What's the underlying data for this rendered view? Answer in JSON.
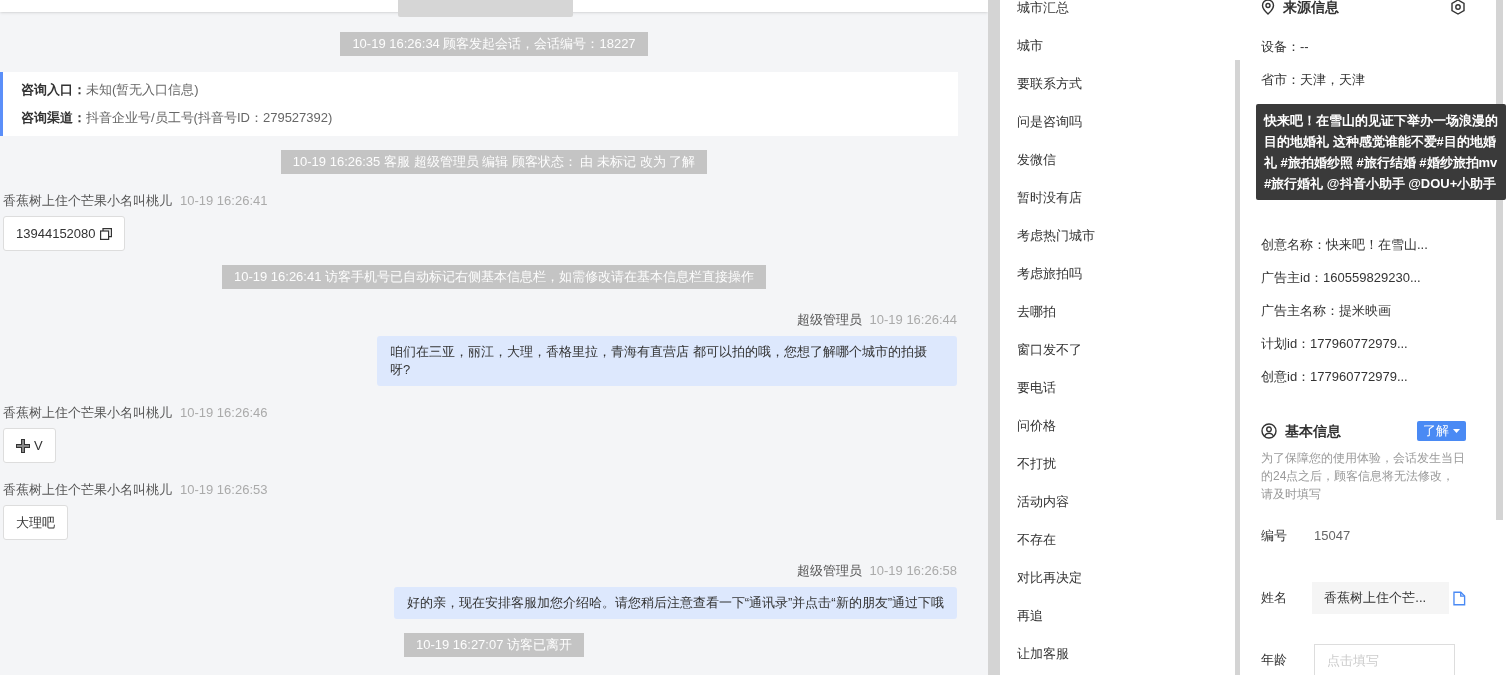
{
  "chat": {
    "messages": [
      {
        "kind": "notice",
        "text": "10-19 16:26:34 顾客发起会话，会话编号：18227"
      },
      {
        "kind": "info",
        "rows": [
          {
            "label": "咨询入口：",
            "value": "未知(暂无入口信息)"
          },
          {
            "label": "咨询渠道：",
            "value": "抖音企业号/员工号(抖音号ID：279527392)"
          }
        ]
      },
      {
        "kind": "notice",
        "text": "10-19 16:26:35 客服 超级管理员 编辑 顾客状态： 由 未标记 改为 了解"
      },
      {
        "kind": "customer",
        "sender": "香蕉树上住个芒果小名叫桃儿",
        "time": "10-19 16:26:41",
        "text": "13944152080",
        "copy": true
      },
      {
        "kind": "notice",
        "text": "10-19 16:26:41 访客手机号已自动标记右侧基本信息栏，如需修改请在基本信息栏直接操作"
      },
      {
        "kind": "agent",
        "sender": "超级管理员",
        "time": "10-19 16:26:44",
        "text": "咱们在三亚，丽江，大理，香格里拉，青海有直营店 都可以拍的哦，您想了解哪个城市的拍摄呀?"
      },
      {
        "kind": "customer",
        "sender": "香蕉树上住个芒果小名叫桃儿",
        "time": "10-19 16:26:46",
        "text": "V",
        "emoji": true
      },
      {
        "kind": "customer",
        "sender": "香蕉树上住个芒果小名叫桃儿",
        "time": "10-19 16:26:53",
        "text": "大理吧"
      },
      {
        "kind": "agent",
        "sender": "超级管理员",
        "time": "10-19 16:26:58",
        "text": "好的亲，现在安排客服加您介绍哈。请您稍后注意查看一下“通讯录”并点击“新的朋友”通过下哦"
      },
      {
        "kind": "notice",
        "text": "10-19 16:27:07 访客已离开"
      }
    ]
  },
  "tags": [
    "城市汇总",
    "城市",
    "要联系方式",
    "问是咨询吗",
    "发微信",
    "暂时没有店",
    "考虑热门城市",
    "考虑旅拍吗",
    "去哪拍",
    "窗口发不了",
    "要电话",
    "问价格",
    "不打扰",
    "活动内容",
    "不存在",
    "对比再决定",
    "再追",
    "让加客服"
  ],
  "source_info": {
    "title": "来源信息",
    "rows_top": [
      "设备：--",
      "省市：天津，天津"
    ],
    "tooltip": "快来吧！在雪山的见证下举办一场浪漫的目的地婚礼 这种感觉谁能不爱#目的地婚礼 #旅拍婚纱照 #旅行结婚 #婚纱旅拍mv #旅行婚礼 @抖音小助手 @DOU+小助手",
    "rows_bottom": [
      "创意名称：快来吧！在雪山...",
      "广告主id：160559829230...",
      "广告主名称：提米映画",
      "计划id：177960772979...",
      "创意id：177960772979..."
    ]
  },
  "basic_info": {
    "title": "基本信息",
    "status": "了解",
    "note": "为了保障您的使用体验，会话发生当日的24点之后，顾客信息将无法修改，请及时填写",
    "fields": [
      {
        "kind": "text",
        "label": "编号",
        "value": "15047"
      },
      {
        "kind": "readonly",
        "label": "姓名",
        "value": "香蕉树上住个芒..."
      },
      {
        "kind": "input",
        "label": "年龄",
        "placeholder": "点击填写"
      }
    ]
  }
}
